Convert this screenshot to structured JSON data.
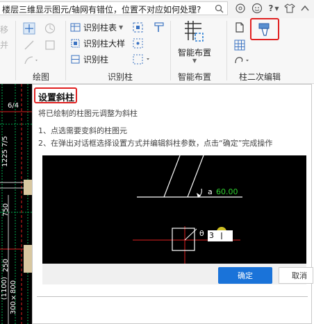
{
  "search": {
    "text": "楼层三维显示图元/轴网有错位，位置不对应如何处理?"
  },
  "toolbar_icons": [
    "help-circle-icon",
    "smile-icon",
    "question-icon",
    "shirt-icon",
    "chevron-up-icon"
  ],
  "help_label": "?",
  "groups": {
    "draw": {
      "label": "绘图"
    },
    "identify": {
      "label": "识别柱",
      "items": [
        "识别柱表",
        "识别柱大样",
        "识别柱"
      ]
    },
    "smart": {
      "label": "智能布置",
      "button_label": "智能布置"
    },
    "edit": {
      "label": "柱二次编辑"
    }
  },
  "left_cut": {
    "row1": "移",
    "row2": "并"
  },
  "panel": {
    "title": "设置斜柱",
    "description": "将已绘制的柱图元调整为斜柱",
    "steps": [
      "1、点选需要变斜的柱图元",
      "2、在弹出对话框选择设置方式并编辑斜柱参数，点击“确定”完成操作"
    ],
    "demo": {
      "angle_label": "a",
      "angle_value": "60.00",
      "theta_label": "θ",
      "input_value": "3"
    },
    "ok_label": "确定",
    "cancel_label": "取消"
  },
  "canvas_labels": {
    "a": "6/4",
    "b": "1225 7/5",
    "c": "750",
    "d": "250",
    "e": "(1100)",
    "f": "300×800"
  },
  "colors": {
    "highlight": "#e02020",
    "primary": "#1a73d9",
    "demo_green": "#2fd02f",
    "demo_red": "#e02020"
  }
}
